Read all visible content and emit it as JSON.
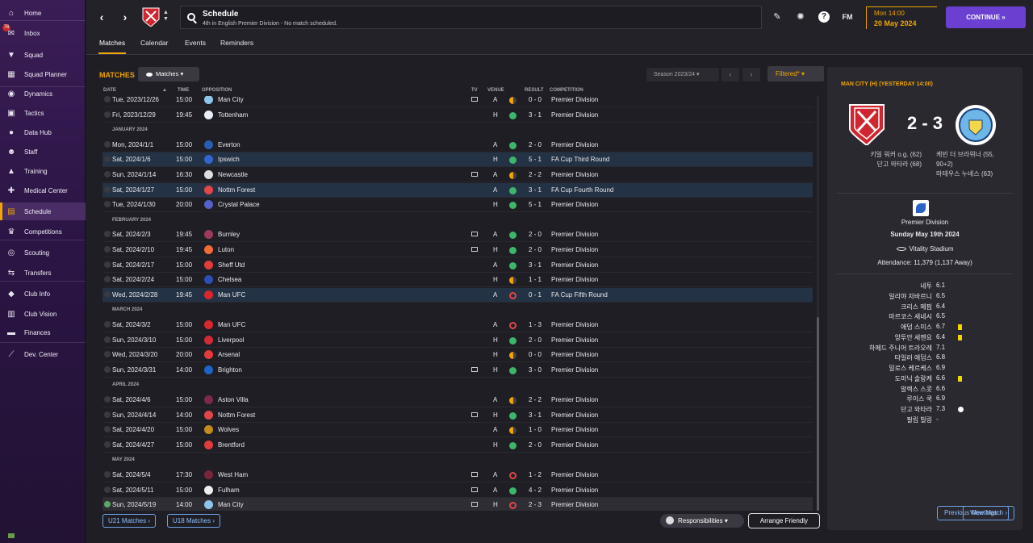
{
  "sidebar": {
    "inbox_badge": "76",
    "items": [
      {
        "label": "Home",
        "icon": "home-icon",
        "glyph": "⌂"
      },
      {
        "label": "Inbox",
        "icon": "inbox-icon",
        "glyph": "✉"
      },
      {
        "label": "Squad",
        "icon": "shirt-icon",
        "glyph": "▼"
      },
      {
        "label": "Squad Planner",
        "icon": "planner-icon",
        "glyph": "▦"
      },
      {
        "label": "Dynamics",
        "icon": "dynamics-icon",
        "glyph": "◉"
      },
      {
        "label": "Tactics",
        "icon": "tactics-icon",
        "glyph": "▣"
      },
      {
        "label": "Data Hub",
        "icon": "data-hub-icon",
        "glyph": "●"
      },
      {
        "label": "Staff",
        "icon": "staff-icon",
        "glyph": "☻"
      },
      {
        "label": "Training",
        "icon": "training-icon",
        "glyph": "▲"
      },
      {
        "label": "Medical Center",
        "icon": "medical-icon",
        "glyph": "✚"
      },
      {
        "label": "Schedule",
        "icon": "schedule-icon",
        "glyph": "▤"
      },
      {
        "label": "Competitions",
        "icon": "trophy-icon",
        "glyph": "♛"
      },
      {
        "label": "Scouting",
        "icon": "scouting-icon",
        "glyph": "◎"
      },
      {
        "label": "Transfers",
        "icon": "transfers-icon",
        "glyph": "⇆"
      },
      {
        "label": "Club Info",
        "icon": "club-info-icon",
        "glyph": "◆"
      },
      {
        "label": "Club Vision",
        "icon": "club-vision-icon",
        "glyph": "▥"
      },
      {
        "label": "Finances",
        "icon": "finances-icon",
        "glyph": "▬"
      },
      {
        "label": "Dev. Center",
        "icon": "dev-center-icon",
        "glyph": "⟋"
      }
    ]
  },
  "topbar": {
    "title": "Schedule",
    "subtitle": "4th in English Premier Division - No match scheduled.",
    "date_time": "Mon 14:00",
    "date": "20 May 2024",
    "continue_label": "CONTINUE  »",
    "fm_label": "FM"
  },
  "tabs": [
    "Matches",
    "Calendar",
    "Events",
    "Reminders"
  ],
  "main": {
    "section_title": "MATCHES",
    "view_dropdown": "Matches",
    "season": "Season 2023/24",
    "filter_label": "Filtered*",
    "columns": {
      "date": "DATE",
      "time": "TIME",
      "opposition": "OPPOSITION",
      "tv": "TV",
      "venue": "VENUE",
      "result": "RESULT",
      "competition": "COMPETITION"
    },
    "months": [
      "JANUARY 2024",
      "FEBRUARY 2024",
      "MARCH 2024",
      "APRIL 2024",
      "MAY 2024"
    ],
    "rows": [
      {
        "date": "Tue, 2023/12/26",
        "time": "15:00",
        "opp": "Man City",
        "venue": "A",
        "result": "0 - 0",
        "outcome": "d",
        "comp": "Premier Division",
        "tv": true,
        "crest": "#8fc4ea"
      },
      {
        "date": "Fri, 2023/12/29",
        "time": "19:45",
        "opp": "Tottenham",
        "venue": "H",
        "result": "3 - 1",
        "outcome": "w",
        "comp": "Premier Division",
        "tv": false,
        "crest": "#e9eef6"
      },
      {
        "date": "Mon, 2024/1/1",
        "time": "15:00",
        "opp": "Everton",
        "venue": "A",
        "result": "2 - 0",
        "outcome": "w",
        "comp": "Premier Division",
        "tv": false,
        "crest": "#2a5db0"
      },
      {
        "date": "Sat, 2024/1/6",
        "time": "15:00",
        "opp": "Ipswich",
        "venue": "H",
        "result": "5 - 1",
        "outcome": "w",
        "comp": "FA Cup Third Round",
        "tv": false,
        "crest": "#3366cc",
        "cup": true
      },
      {
        "date": "Sun, 2024/1/14",
        "time": "16:30",
        "opp": "Newcastle",
        "venue": "A",
        "result": "2 - 2",
        "outcome": "d",
        "comp": "Premier Division",
        "tv": true,
        "crest": "#dddddd"
      },
      {
        "date": "Sat, 2024/1/27",
        "time": "15:00",
        "opp": "Nottm Forest",
        "venue": "A",
        "result": "3 - 1",
        "outcome": "w",
        "comp": "FA Cup Fourth Round",
        "tv": false,
        "crest": "#e0464a",
        "cup": true
      },
      {
        "date": "Tue, 2024/1/30",
        "time": "20:00",
        "opp": "Crystal Palace",
        "venue": "H",
        "result": "5 - 1",
        "outcome": "w",
        "comp": "Premier Division",
        "tv": false,
        "crest": "#5561c7"
      },
      {
        "date": "Sat, 2024/2/3",
        "time": "19:45",
        "opp": "Burnley",
        "venue": "A",
        "result": "2 - 0",
        "outcome": "w",
        "comp": "Premier Division",
        "tv": true,
        "crest": "#9a3b5a"
      },
      {
        "date": "Sat, 2024/2/10",
        "time": "19:45",
        "opp": "Luton",
        "venue": "H",
        "result": "2 - 0",
        "outcome": "w",
        "comp": "Premier Division",
        "tv": true,
        "crest": "#f06a3a"
      },
      {
        "date": "Sat, 2024/2/17",
        "time": "15:00",
        "opp": "Sheff Utd",
        "venue": "A",
        "result": "3 - 1",
        "outcome": "w",
        "comp": "Premier Division",
        "tv": false,
        "crest": "#e23b3b"
      },
      {
        "date": "Sat, 2024/2/24",
        "time": "15:00",
        "opp": "Chelsea",
        "venue": "H",
        "result": "1 - 1",
        "outcome": "d",
        "comp": "Premier Division",
        "tv": false,
        "crest": "#2b4fb3"
      },
      {
        "date": "Wed, 2024/2/28",
        "time": "19:45",
        "opp": "Man UFC",
        "venue": "A",
        "result": "0 - 1",
        "outcome": "l",
        "comp": "FA Cup Fifth Round",
        "tv": false,
        "crest": "#d9272e",
        "cup": true
      },
      {
        "date": "Sat, 2024/3/2",
        "time": "15:00",
        "opp": "Man UFC",
        "venue": "A",
        "result": "1 - 3",
        "outcome": "l",
        "comp": "Premier Division",
        "tv": false,
        "crest": "#d9272e"
      },
      {
        "date": "Sun, 2024/3/10",
        "time": "15:00",
        "opp": "Liverpool",
        "venue": "H",
        "result": "2 - 0",
        "outcome": "w",
        "comp": "Premier Division",
        "tv": false,
        "crest": "#d22b37"
      },
      {
        "date": "Wed, 2024/3/20",
        "time": "20:00",
        "opp": "Arsenal",
        "venue": "H",
        "result": "0 - 0",
        "outcome": "d",
        "comp": "Premier Division",
        "tv": false,
        "crest": "#e23b3b"
      },
      {
        "date": "Sun, 2024/3/31",
        "time": "14:00",
        "opp": "Brighton",
        "venue": "H",
        "result": "3 - 0",
        "outcome": "w",
        "comp": "Premier Division",
        "tv": true,
        "crest": "#1e63c6"
      },
      {
        "date": "Sat, 2024/4/6",
        "time": "15:00",
        "opp": "Aston Villa",
        "venue": "A",
        "result": "2 - 2",
        "outcome": "d",
        "comp": "Premier Division",
        "tv": false,
        "crest": "#7a2a4e"
      },
      {
        "date": "Sun, 2024/4/14",
        "time": "14:00",
        "opp": "Nottm Forest",
        "venue": "H",
        "result": "3 - 1",
        "outcome": "w",
        "comp": "Premier Division",
        "tv": true,
        "crest": "#e0464a"
      },
      {
        "date": "Sat, 2024/4/20",
        "time": "15:00",
        "opp": "Wolves",
        "venue": "A",
        "result": "1 - 0",
        "outcome": "d",
        "comp": "Premier Division",
        "tv": false,
        "crest": "#c28b1c"
      },
      {
        "date": "Sat, 2024/4/27",
        "time": "15:00",
        "opp": "Brentford",
        "venue": "H",
        "result": "2 - 0",
        "outcome": "w",
        "comp": "Premier Division",
        "tv": false,
        "crest": "#e23b3b"
      },
      {
        "date": "Sat, 2024/5/4",
        "time": "17:30",
        "opp": "West Ham",
        "venue": "A",
        "result": "1 - 2",
        "outcome": "l",
        "comp": "Premier Division",
        "tv": true,
        "crest": "#7a263a"
      },
      {
        "date": "Sat, 2024/5/11",
        "time": "15:00",
        "opp": "Fulham",
        "venue": "A",
        "result": "4 - 2",
        "outcome": "w",
        "comp": "Premier Division",
        "tv": true,
        "crest": "#eeeeee"
      },
      {
        "date": "Sun, 2024/5/19",
        "time": "14:00",
        "opp": "Man City",
        "venue": "H",
        "result": "2 - 3",
        "outcome": "l",
        "comp": "Premier Division",
        "tv": true,
        "crest": "#8fc4ea",
        "last": true
      }
    ],
    "u21_label": "U21 Matches",
    "u18_label": "U18 Matches",
    "responsibilities_label": "Responsibilities",
    "friendly_label": "Arrange Friendly"
  },
  "match_panel": {
    "title": "MAN CITY (H) (YESTERDAY 14:00)",
    "score": "2 - 3",
    "home_scorers": [
      "키일 워커 o.g. (62)",
      "단고 와타라 (68)"
    ],
    "away_scorers": [
      "케빈 더 브라위너 (55,",
      "90+2)",
      "마테우스 누녜스 (63)"
    ],
    "competition": "Premier Division",
    "match_date": "Sunday May 19th 2024",
    "stadium": "Vitality Stadium",
    "attendance": "Attendance: 11,379 (1,137 Away)",
    "ratings": [
      {
        "name": "네투",
        "rating": "6.1"
      },
      {
        "name": "일리야 자바르니",
        "rating": "6.5"
      },
      {
        "name": "크리스 메핌",
        "rating": "6.4"
      },
      {
        "name": "마르코스 세네시",
        "rating": "6.5"
      },
      {
        "name": "애덤 스미스",
        "rating": "6.7",
        "mark": "card"
      },
      {
        "name": "앙투안 세멘요",
        "rating": "6.4",
        "mark": "card"
      },
      {
        "name": "하메드 주니어 트라오레",
        "rating": "7.1"
      },
      {
        "name": "타일러 애덤스",
        "rating": "6.8"
      },
      {
        "name": "밀로스 케르케스",
        "rating": "6.9"
      },
      {
        "name": "도미닉 솔랑케",
        "rating": "6.6",
        "mark": "card"
      },
      {
        "name": "알렉스 스콧",
        "rating": "6.6"
      },
      {
        "name": "루이스 쿡",
        "rating": "6.9"
      },
      {
        "name": "단고 와타라",
        "rating": "7.3",
        "mark": "ball"
      },
      {
        "name": "필립 빌링",
        "rating": "-"
      }
    ],
    "prev_meetings_label": "Previous Meetings",
    "view_match_label": "View Match"
  }
}
